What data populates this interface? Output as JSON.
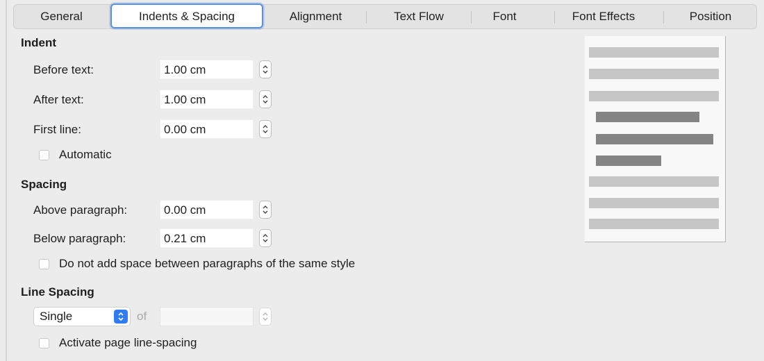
{
  "tabs": [
    {
      "label": "General",
      "selected": false
    },
    {
      "label": "Indents & Spacing",
      "selected": true
    },
    {
      "label": "Alignment",
      "selected": false
    },
    {
      "label": "Text Flow",
      "selected": false
    },
    {
      "label": "Font",
      "selected": false
    },
    {
      "label": "Font Effects",
      "selected": false
    },
    {
      "label": "Position",
      "selected": false
    }
  ],
  "indent": {
    "heading": "Indent",
    "before_text": {
      "label": "Before text:",
      "value": "1.00 cm"
    },
    "after_text": {
      "label": "After text:",
      "value": "1.00 cm"
    },
    "first_line": {
      "label": "First line:",
      "value": "0.00 cm"
    },
    "automatic": {
      "label": "Automatic",
      "checked": false
    }
  },
  "spacing": {
    "heading": "Spacing",
    "above_paragraph": {
      "label": "Above paragraph:",
      "value": "0.00 cm"
    },
    "below_paragraph": {
      "label": "Below paragraph:",
      "value": "0.21 cm"
    },
    "no_space_same_style": {
      "label": "Do not add space between paragraphs of the same style",
      "checked": false
    }
  },
  "line_spacing": {
    "heading": "Line Spacing",
    "mode": "Single",
    "of_label": "of",
    "of_value": "",
    "page_line_spacing": {
      "label": "Activate page line-spacing",
      "checked": false
    }
  },
  "colors": {
    "accent": "#2f7df6",
    "tab_focus": "#5a8fe0",
    "preview_light": "#c6c6c6",
    "preview_dark": "#848484"
  }
}
